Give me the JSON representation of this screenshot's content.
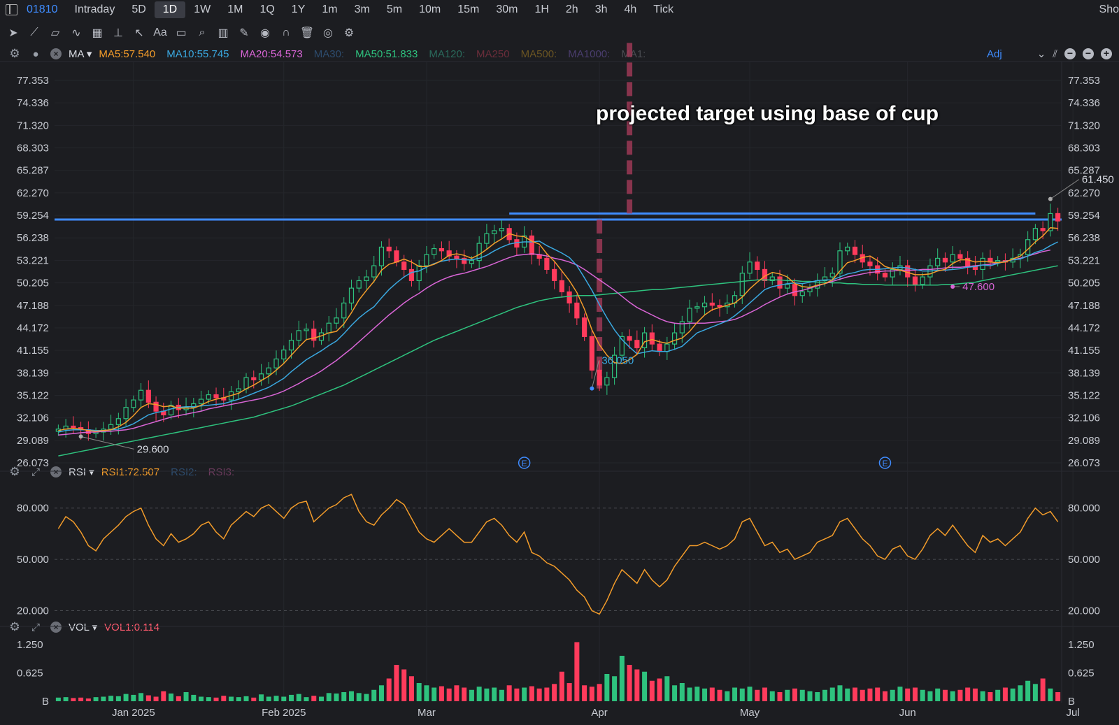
{
  "symbol": "01810",
  "timeframes": [
    "Intraday",
    "5D",
    "1D",
    "1W",
    "1M",
    "1Q",
    "1Y",
    "1m",
    "3m",
    "5m",
    "10m",
    "15m",
    "30m",
    "1H",
    "2h",
    "3h",
    "4h",
    "Tick"
  ],
  "active_timeframe": "1D",
  "show_label": "Sho",
  "toolbar_icons": [
    "cursor-icon",
    "trendline-icon",
    "channel-icon",
    "wave-icon",
    "fib-icon",
    "measure-icon",
    "arrow-icon",
    "text-icon",
    "comment-icon",
    "zoom-icon",
    "pattern-icon",
    "brush-icon",
    "eye-icon",
    "magnet-icon",
    "trash-icon",
    "layers-icon",
    "settings-icon"
  ],
  "ma_panel": {
    "name": "MA",
    "items": [
      {
        "label": "MA5:57.540",
        "color": "#f39c2a"
      },
      {
        "label": "MA10:55.745",
        "color": "#3aa8e0"
      },
      {
        "label": "MA20:54.573",
        "color": "#d965d6"
      },
      {
        "label": "MA30:",
        "color": "#2d4c6e"
      },
      {
        "label": "MA50:51.833",
        "color": "#2ec27e"
      },
      {
        "label": "MA120:",
        "color": "#2a6b5c"
      },
      {
        "label": "MA250",
        "color": "#6b2d3a"
      },
      {
        "label": "MA500:",
        "color": "#6b5522"
      },
      {
        "label": "MA1000:",
        "color": "#4a3d6e"
      },
      {
        "label": "MA1:",
        "color": "#4a4c52"
      }
    ],
    "adj_label": "Adj"
  },
  "rsi_panel": {
    "name": "RSI",
    "items": [
      {
        "label": "RSI1:72.507",
        "color": "#f39c2a"
      },
      {
        "label": "RSI2:",
        "color": "#2d4c6e"
      },
      {
        "label": "RSI3:",
        "color": "#6b3a5c"
      }
    ]
  },
  "vol_panel": {
    "name": "VOL",
    "items": [
      {
        "label": "VOL1:0.114",
        "color": "#ff5a6e"
      }
    ]
  },
  "annotation": "projected target using base of cup",
  "chart_data": {
    "type": "candlestick",
    "price_ticks": [
      "77.353",
      "74.336",
      "71.320",
      "68.303",
      "65.287",
      "62.270",
      "59.254",
      "56.238",
      "53.221",
      "50.205",
      "47.188",
      "44.172",
      "41.155",
      "38.139",
      "35.122",
      "32.106",
      "29.089",
      "26.073"
    ],
    "price_range": [
      26.073,
      77.353
    ],
    "rsi_ticks": [
      "80.000",
      "50.000",
      "20.000"
    ],
    "rsi_range": [
      10,
      95
    ],
    "vol_ticks": [
      "1.250",
      "0.625",
      "B"
    ],
    "vol_range": [
      0,
      1.4
    ],
    "x_labels": [
      {
        "label": "Jan 2025",
        "index": 10
      },
      {
        "label": "Feb 2025",
        "index": 30
      },
      {
        "label": "Mar",
        "index": 49
      },
      {
        "label": "Apr",
        "index": 72
      },
      {
        "label": "May",
        "index": 92
      },
      {
        "label": "Jun",
        "index": 113
      },
      {
        "label": "Jul",
        "index": 135
      }
    ],
    "annotations": [
      {
        "label": "29.600",
        "index": 3,
        "value": 29.6
      },
      {
        "label": "36.050",
        "index": 71,
        "value": 36.05
      },
      {
        "label": "47.600",
        "index": 119,
        "value": 49.7
      },
      {
        "label": "61.450",
        "index": 132,
        "value": 61.45
      }
    ],
    "resistance_level": 58.7,
    "cup_rim_level": 59.5,
    "earnings_markers": [
      {
        "label": "E",
        "index": 62
      },
      {
        "label": "E",
        "index": 110
      }
    ],
    "closes": [
      30.6,
      31.0,
      30.8,
      30.5,
      30.0,
      30.2,
      30.6,
      31.2,
      32.0,
      33.5,
      34.5,
      35.8,
      34.2,
      33.0,
      32.5,
      33.8,
      33.2,
      33.5,
      34.0,
      34.6,
      35.2,
      34.8,
      34.5,
      35.6,
      36.0,
      37.5,
      37.2,
      38.0,
      38.8,
      40.0,
      41.2,
      42.5,
      43.8,
      44.0,
      42.5,
      43.5,
      44.8,
      45.5,
      47.5,
      49.5,
      50.5,
      51.0,
      52.5,
      55.0,
      54.5,
      53.0,
      52.0,
      50.5,
      52.5,
      54.0,
      54.8,
      54.5,
      53.8,
      53.5,
      52.8,
      53.2,
      55.5,
      56.8,
      57.2,
      57.5,
      56.0,
      55.0,
      56.5,
      54.0,
      53.5,
      52.0,
      50.5,
      49.0,
      47.5,
      45.5,
      43.0,
      38.5,
      36.5,
      37.5,
      40.5,
      43.0,
      42.5,
      41.5,
      43.5,
      42.0,
      41.0,
      42.0,
      43.5,
      45.0,
      46.8,
      47.0,
      47.5,
      47.2,
      47.0,
      47.5,
      48.5,
      51.5,
      53.0,
      52.0,
      50.5,
      51.0,
      49.5,
      50.0,
      48.5,
      49.0,
      49.5,
      50.5,
      51.0,
      51.5,
      54.5,
      55.0,
      54.0,
      53.0,
      52.5,
      51.5,
      51.0,
      52.0,
      52.5,
      51.0,
      50.0,
      51.0,
      52.5,
      53.5,
      53.0,
      54.0,
      53.5,
      52.5,
      52.0,
      53.5,
      53.0,
      53.2,
      53.0,
      53.5,
      54.0,
      56.0,
      57.5,
      57.2,
      59.5,
      58.5
    ],
    "volumes": [
      0.08,
      0.09,
      0.07,
      0.08,
      0.06,
      0.09,
      0.1,
      0.12,
      0.11,
      0.16,
      0.14,
      0.18,
      0.13,
      0.1,
      0.22,
      0.17,
      0.11,
      0.2,
      0.14,
      0.1,
      0.09,
      0.08,
      0.12,
      0.1,
      0.09,
      0.11,
      0.08,
      0.15,
      0.1,
      0.12,
      0.1,
      0.14,
      0.16,
      0.09,
      0.12,
      0.1,
      0.18,
      0.17,
      0.2,
      0.22,
      0.18,
      0.16,
      0.25,
      0.35,
      0.5,
      0.8,
      0.7,
      0.55,
      0.4,
      0.35,
      0.3,
      0.33,
      0.28,
      0.35,
      0.3,
      0.25,
      0.32,
      0.28,
      0.3,
      0.25,
      0.35,
      0.28,
      0.3,
      0.33,
      0.28,
      0.3,
      0.38,
      0.65,
      0.4,
      1.3,
      0.35,
      0.32,
      0.38,
      0.6,
      0.55,
      1.0,
      0.8,
      0.7,
      0.65,
      0.45,
      0.5,
      0.55,
      0.35,
      0.4,
      0.3,
      0.32,
      0.28,
      0.3,
      0.25,
      0.22,
      0.3,
      0.28,
      0.32,
      0.25,
      0.3,
      0.22,
      0.2,
      0.25,
      0.28,
      0.25,
      0.22,
      0.2,
      0.25,
      0.3,
      0.35,
      0.28,
      0.3,
      0.25,
      0.28,
      0.3,
      0.22,
      0.25,
      0.32,
      0.28,
      0.3,
      0.25,
      0.22,
      0.28,
      0.25,
      0.22,
      0.25,
      0.3,
      0.28,
      0.22,
      0.2,
      0.25,
      0.3,
      0.28,
      0.35,
      0.45,
      0.38,
      0.5,
      0.28,
      0.2
    ],
    "ma5": [
      30.4,
      30.6,
      30.7,
      30.6,
      30.4,
      30.3,
      30.4,
      30.5,
      30.9,
      31.5,
      32.4,
      33.5,
      34.0,
      33.9,
      33.6,
      33.7,
      33.4,
      33.4,
      33.4,
      33.8,
      34.3,
      34.6,
      34.8,
      35.1,
      35.4,
      36.0,
      36.5,
      37.1,
      37.7,
      38.5,
      39.4,
      40.5,
      41.6,
      42.6,
      42.8,
      43.1,
      43.5,
      43.7,
      44.7,
      46.2,
      47.9,
      49.2,
      50.4,
      51.9,
      52.7,
      53.0,
      53.4,
      53.0,
      52.4,
      52.4,
      52.7,
      53.2,
      53.9,
      54.1,
      53.9,
      53.5,
      54.0,
      54.7,
      55.5,
      56.1,
      56.8,
      56.5,
      56.4,
      55.8,
      55.4,
      54.1,
      53.1,
      51.8,
      50.5,
      48.9,
      46.7,
      43.9,
      41.9,
      40.5,
      39.5,
      39.4,
      39.9,
      40.6,
      42.3,
      42.6,
      42.3,
      42.1,
      42.5,
      42.8,
      43.7,
      44.9,
      45.9,
      46.6,
      46.9,
      47.2,
      47.5,
      48.3,
      49.4,
      50.3,
      51.1,
      51.6,
      51.4,
      51.0,
      50.1,
      49.7,
      49.6,
      49.9,
      50.1,
      50.6,
      51.8,
      52.9,
      53.2,
      53.6,
      53.8,
      53.2,
      52.4,
      52.1,
      51.9,
      51.6,
      51.3,
      51.3,
      51.4,
      51.8,
      52.0,
      52.8,
      53.3,
      53.3,
      53.0,
      53.1,
      53.0,
      52.9,
      53.0,
      53.4,
      53.8,
      54.7,
      55.7,
      56.5,
      57.6,
      57.5
    ],
    "ma10": [
      30.2,
      30.4,
      30.5,
      30.5,
      30.5,
      30.4,
      30.4,
      30.5,
      30.6,
      30.9,
      31.3,
      31.9,
      32.5,
      32.8,
      33.0,
      33.3,
      33.5,
      33.6,
      33.6,
      33.7,
      33.8,
      33.9,
      34.0,
      34.3,
      34.6,
      35.0,
      35.4,
      35.8,
      36.2,
      36.8,
      37.4,
      38.3,
      39.1,
      39.9,
      40.5,
      41.1,
      41.8,
      42.4,
      43.4,
      44.5,
      45.5,
      46.3,
      47.0,
      48.2,
      49.3,
      50.2,
      51.0,
      51.6,
      51.8,
      52.3,
      52.8,
      53.1,
      53.3,
      53.4,
      53.3,
      53.3,
      53.5,
      53.9,
      54.5,
      55.0,
      55.4,
      55.6,
      55.7,
      55.7,
      55.8,
      55.2,
      54.7,
      54.2,
      53.6,
      52.5,
      50.9,
      49.2,
      47.3,
      45.5,
      43.9,
      42.6,
      41.6,
      40.7,
      40.9,
      41.1,
      41.0,
      41.0,
      41.3,
      41.7,
      42.6,
      43.5,
      43.9,
      44.3,
      44.7,
      45.1,
      45.8,
      46.6,
      47.5,
      48.4,
      49.3,
      49.7,
      49.9,
      50.1,
      50.2,
      50.1,
      50.3,
      50.5,
      50.6,
      50.6,
      51.0,
      51.4,
      51.6,
      51.9,
      52.0,
      52.0,
      52.1,
      52.2,
      52.3,
      52.2,
      52.0,
      51.8,
      51.8,
      51.9,
      51.9,
      52.0,
      52.1,
      52.3,
      52.4,
      52.6,
      52.5,
      52.8,
      53.1,
      53.3,
      53.4,
      53.8,
      54.3,
      54.6,
      55.2,
      55.7
    ],
    "ma20": [
      29.8,
      29.9,
      30.0,
      30.1,
      30.2,
      30.2,
      30.3,
      30.3,
      30.4,
      30.5,
      30.7,
      31.0,
      31.3,
      31.6,
      31.9,
      32.2,
      32.4,
      32.6,
      32.8,
      33.0,
      33.3,
      33.5,
      33.7,
      33.9,
      34.1,
      34.3,
      34.5,
      34.7,
      35.0,
      35.3,
      35.7,
      36.2,
      36.7,
      37.3,
      37.8,
      38.4,
      39.1,
      39.8,
      40.6,
      41.4,
      42.3,
      43.2,
      44.1,
      45.0,
      45.9,
      46.7,
      47.5,
      48.2,
      48.8,
      49.5,
      50.1,
      50.6,
      51.0,
      51.3,
      51.5,
      51.8,
      52.1,
      52.4,
      52.8,
      53.2,
      53.6,
      53.9,
      54.0,
      54.1,
      54.0,
      53.8,
      53.5,
      53.3,
      53.0,
      52.6,
      52.0,
      51.3,
      50.6,
      49.9,
      49.2,
      48.4,
      47.6,
      46.9,
      46.4,
      45.9,
      45.4,
      45.0,
      44.8,
      44.7,
      44.8,
      44.8,
      44.8,
      44.9,
      45.0,
      45.1,
      45.3,
      45.7,
      46.2,
      46.7,
      47.3,
      47.8,
      48.3,
      48.7,
      49.0,
      49.2,
      49.5,
      49.8,
      50.1,
      50.4,
      50.7,
      51.0,
      51.2,
      51.4,
      51.6,
      51.7,
      51.8,
      51.8,
      51.9,
      51.9,
      51.9,
      52.0,
      52.0,
      52.1,
      52.2,
      52.3,
      52.3,
      52.4,
      52.5,
      52.6,
      52.7,
      52.9,
      53.1,
      53.3,
      53.5,
      53.8,
      54.1,
      54.4,
      54.6
    ],
    "ma50": [
      27.0,
      27.2,
      27.4,
      27.6,
      27.8,
      28.0,
      28.2,
      28.4,
      28.6,
      28.8,
      29.0,
      29.2,
      29.4,
      29.6,
      29.8,
      30.0,
      30.2,
      30.4,
      30.6,
      30.8,
      31.0,
      31.2,
      31.4,
      31.6,
      31.8,
      32.0,
      32.2,
      32.5,
      32.8,
      33.1,
      33.4,
      33.7,
      34.1,
      34.5,
      34.9,
      35.3,
      35.7,
      36.1,
      36.5,
      37.0,
      37.5,
      38.0,
      38.5,
      39.0,
      39.5,
      40.0,
      40.5,
      41.0,
      41.5,
      42.0,
      42.5,
      42.9,
      43.3,
      43.7,
      44.1,
      44.5,
      44.9,
      45.3,
      45.7,
      46.1,
      46.5,
      46.9,
      47.2,
      47.5,
      47.8,
      48.0,
      48.2,
      48.3,
      48.4,
      48.5,
      48.5,
      48.5,
      48.6,
      48.7,
      48.8,
      48.9,
      49.0,
      49.1,
      49.2,
      49.3,
      49.3,
      49.4,
      49.5,
      49.6,
      49.7,
      49.8,
      49.9,
      50.0,
      50.1,
      50.2,
      50.3,
      50.4,
      50.5,
      50.6,
      50.6,
      50.6,
      50.6,
      50.5,
      50.5,
      50.4,
      50.4,
      50.3,
      50.3,
      50.2,
      50.2,
      50.1,
      50.1,
      50.0,
      50.0,
      50.0,
      49.9,
      49.9,
      49.9,
      49.9,
      49.9,
      49.9,
      49.9,
      49.9,
      50.0,
      50.0,
      50.1,
      50.2,
      50.3,
      50.5,
      50.7,
      50.9,
      51.1,
      51.3,
      51.5,
      51.7,
      51.9,
      52.1,
      52.3,
      52.5
    ],
    "rsi": [
      68,
      75,
      72,
      66,
      58,
      55,
      62,
      66,
      70,
      75,
      78,
      80,
      70,
      62,
      58,
      65,
      60,
      62,
      65,
      70,
      72,
      66,
      62,
      70,
      74,
      78,
      75,
      80,
      82,
      78,
      74,
      80,
      83,
      84,
      72,
      76,
      80,
      82,
      86,
      88,
      78,
      72,
      70,
      76,
      80,
      85,
      82,
      74,
      66,
      62,
      60,
      64,
      68,
      64,
      60,
      60,
      66,
      72,
      74,
      70,
      64,
      60,
      66,
      54,
      52,
      48,
      46,
      42,
      38,
      32,
      28,
      20,
      18,
      26,
      36,
      44,
      40,
      36,
      44,
      38,
      34,
      38,
      46,
      52,
      58,
      58,
      60,
      58,
      56,
      58,
      62,
      72,
      74,
      66,
      58,
      60,
      54,
      56,
      50,
      52,
      54,
      60,
      62,
      64,
      72,
      74,
      68,
      62,
      58,
      52,
      50,
      56,
      58,
      52,
      50,
      56,
      64,
      68,
      64,
      70,
      64,
      58,
      54,
      64,
      60,
      62,
      58,
      62,
      66,
      74,
      80,
      76,
      78,
      72
    ]
  }
}
